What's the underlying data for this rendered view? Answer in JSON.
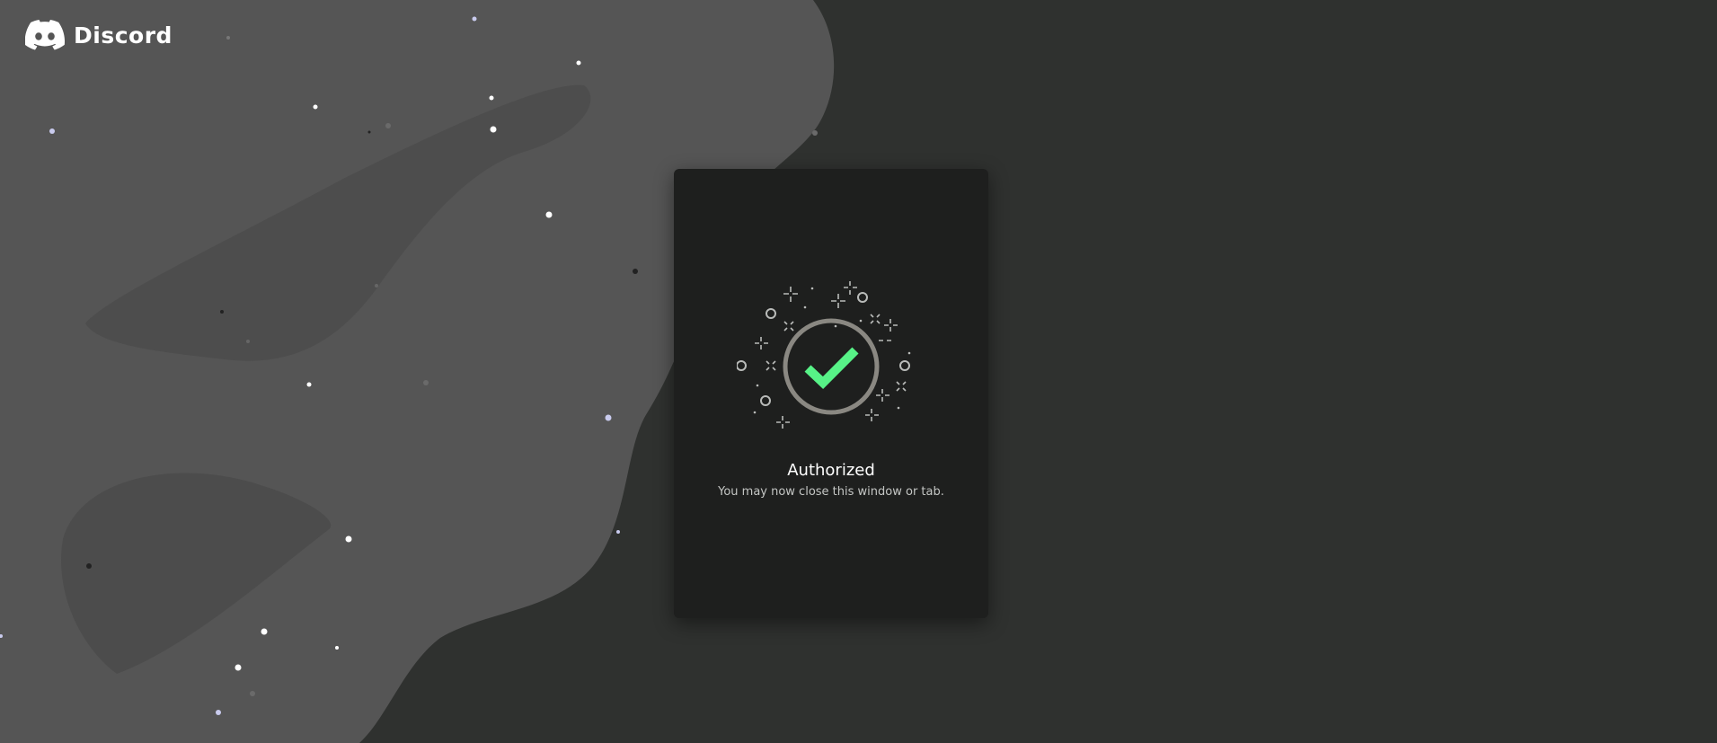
{
  "brand": {
    "name": "Discord",
    "logo_icon": "discord-clyde-icon",
    "logo_color": "#ffffff"
  },
  "authorization": {
    "title": "Authorized",
    "subtitle": "You may now close this window or tab.",
    "status_icon": "checkmark-icon",
    "check_color": "#57f287",
    "ring_color": "#8a8882"
  },
  "colors": {
    "page_background": "#2f312f",
    "blob_background": "#555555",
    "card_background": "#1e1f1e"
  }
}
